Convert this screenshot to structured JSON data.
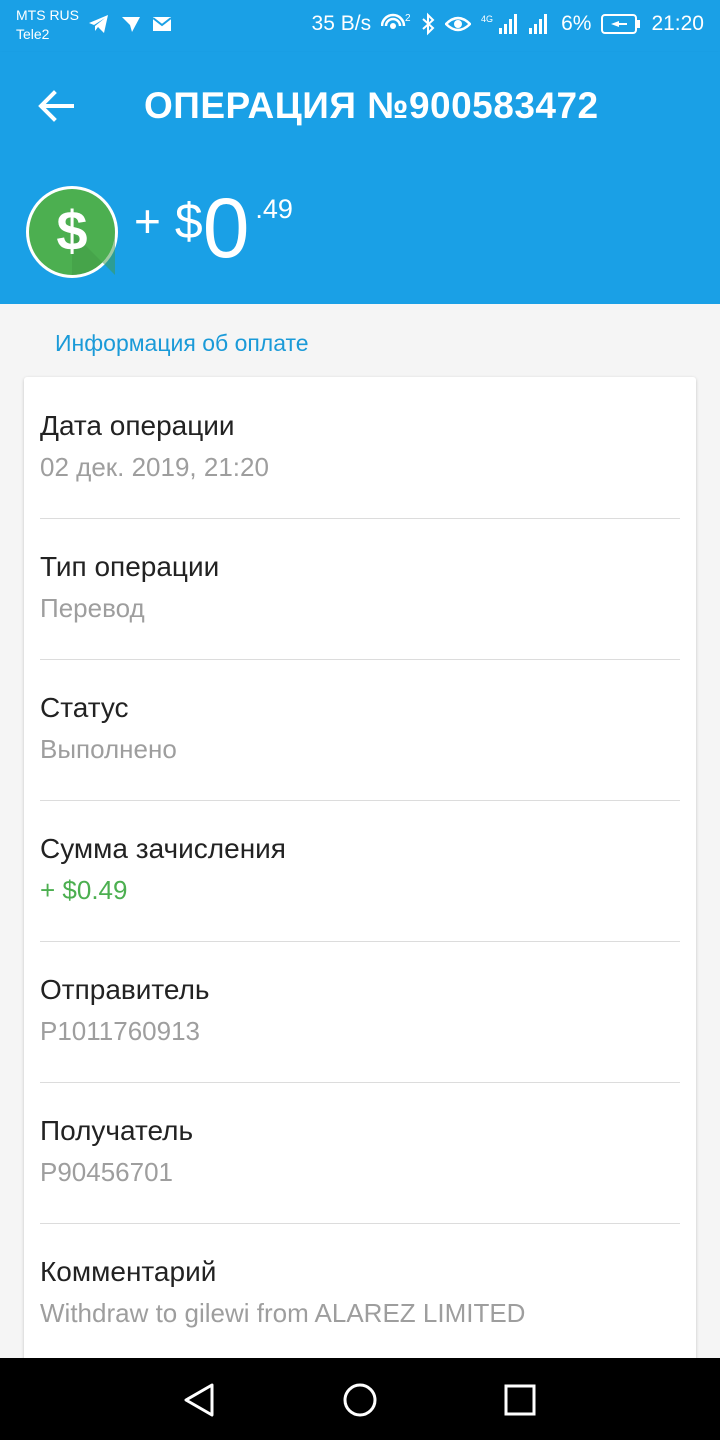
{
  "statusbar": {
    "carrier1": "MTS RUS",
    "carrier2": "Tele2",
    "speed": "35 B/s",
    "battery": "6%",
    "time": "21:20",
    "left_icons": [
      "telegram-icon",
      "telegram-icon",
      "mail-icon"
    ],
    "right_icons": [
      "hotspot-icon",
      "bluetooth-icon",
      "eye-icon",
      "4g-signal-icon",
      "signal-icon",
      "battery-icon"
    ]
  },
  "appbar": {
    "title": "ОПЕРАЦИЯ №900583472",
    "back_icon": "arrow-back-icon"
  },
  "amount": {
    "sign": "+",
    "currency": "$",
    "integer": "0",
    "decimals": ".49",
    "icon": "dollar-coin-icon"
  },
  "section_title": "Информация об оплате",
  "details": [
    {
      "label": "Дата операции",
      "value": "02 дек. 2019, 21:20"
    },
    {
      "label": "Тип операции",
      "value": "Перевод"
    },
    {
      "label": "Статус",
      "value": "Выполнено"
    },
    {
      "label": "Сумма зачисления",
      "value": "+ $0.49"
    },
    {
      "label": "Отправитель",
      "value": "P1011760913"
    },
    {
      "label": "Получатель",
      "value": "P90456701"
    },
    {
      "label": "Комментарий",
      "value": "Withdraw to gilewi from ALAREZ LIMITED"
    }
  ],
  "colors": {
    "primary": "#1aa0e6",
    "accent_green": "#4caf50",
    "section_title": "#1a9ad8"
  },
  "navbar": {
    "icons": [
      "back-triangle-icon",
      "home-circle-icon",
      "recents-square-icon"
    ]
  }
}
